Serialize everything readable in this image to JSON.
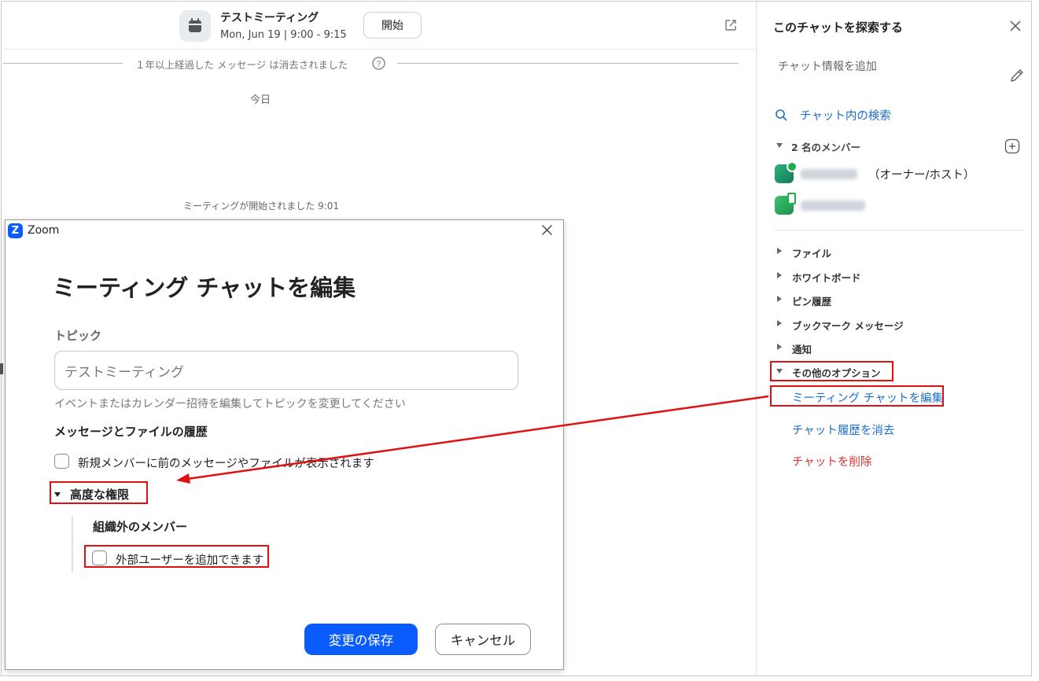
{
  "header": {
    "meeting_title": "テストミーティング",
    "meeting_time": "Mon, Jun 19 | 9:00 - 9:15",
    "start_button": "開始",
    "calendar_icon": "calendar-icon",
    "external_icon": "open-external-icon"
  },
  "chat": {
    "old_messages_notice": "１年以上経過した メッセージ は消去されました",
    "today_label": "今日",
    "meeting_started": "ミーティングが開始されました 9:01"
  },
  "panel": {
    "title": "このチャットを探索する",
    "add_info": "チャット情報を追加",
    "search_in_chat": "チャット内の検索",
    "members_label": "2 名のメンバー",
    "owner_suffix": "（オーナー/ホスト）",
    "sections": {
      "files": "ファイル",
      "whiteboard": "ホワイトボード",
      "pin_history": "ピン履歴",
      "bookmarks": "ブックマーク メッセージ",
      "notifications": "通知",
      "other_options": "その他のオプション"
    },
    "options": {
      "edit_meeting_chat": "ミーティング チャットを編集",
      "clear_history": "チャット履歴を消去",
      "delete_chat": "チャットを削除"
    }
  },
  "dialog": {
    "app_logo": "Z",
    "app_name": "Zoom",
    "heading": "ミーティング チャットを編集",
    "topic_label": "トピック",
    "topic_value": "テストミーティング",
    "topic_help": "イベントまたはカレンダー招待を編集してトピックを変更してください",
    "history_label": "メッセージとファイルの履歴",
    "history_checkbox": "新規メンバーに前のメッセージやファイルが表示されます",
    "advanced_label": "高度な権限",
    "external_members_label": "組織外のメンバー",
    "external_checkbox": "外部ユーザーを追加できます",
    "save_button": "変更の保存",
    "cancel_button": "キャンセル"
  },
  "colors": {
    "accent": "#0b5cff",
    "link": "#1c6fd1",
    "danger": "#e0322f",
    "annotation": "#e01010",
    "online": "#19b24b"
  }
}
